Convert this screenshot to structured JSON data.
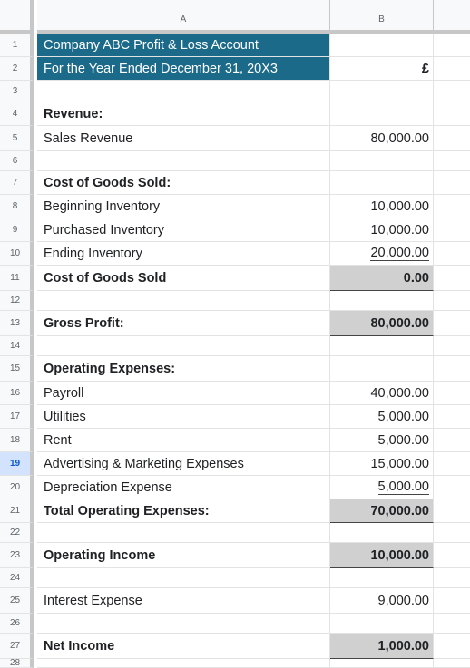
{
  "columns": [
    "A",
    "B"
  ],
  "selected_row": "19",
  "rows": [
    {
      "num": "1",
      "a": "Company ABC Profit & Loss Account",
      "b": "",
      "style": "title"
    },
    {
      "num": "2",
      "a": "For the Year Ended December 31, 20X3",
      "b": "£",
      "style": "title"
    },
    {
      "num": "3",
      "a": "",
      "b": "",
      "style": "blank"
    },
    {
      "num": "4",
      "a": "Revenue:",
      "b": "",
      "style": "header"
    },
    {
      "num": "5",
      "a": "Sales Revenue",
      "b": "80,000.00",
      "style": "normal"
    },
    {
      "num": "6",
      "a": "",
      "b": "",
      "style": "blank"
    },
    {
      "num": "7",
      "a": "Cost of Goods Sold:",
      "b": "",
      "style": "header"
    },
    {
      "num": "8",
      "a": "Beginning Inventory",
      "b": "10,000.00",
      "style": "normal"
    },
    {
      "num": "9",
      "a": "Purchased Inventory",
      "b": "10,000.00",
      "style": "normal"
    },
    {
      "num": "10",
      "a": "Ending Inventory",
      "b": "20,000.00",
      "style": "underline"
    },
    {
      "num": "11",
      "a": "Cost of Goods Sold",
      "b": "0.00",
      "style": "total"
    },
    {
      "num": "12",
      "a": "",
      "b": "",
      "style": "blank"
    },
    {
      "num": "13",
      "a": "Gross Profit:",
      "b": "80,000.00",
      "style": "total"
    },
    {
      "num": "14",
      "a": "",
      "b": "",
      "style": "blank"
    },
    {
      "num": "15",
      "a": "Operating Expenses:",
      "b": "",
      "style": "header"
    },
    {
      "num": "16",
      "a": "Payroll",
      "b": "40,000.00",
      "style": "normal"
    },
    {
      "num": "17",
      "a": "Utilities",
      "b": "5,000.00",
      "style": "normal"
    },
    {
      "num": "18",
      "a": "Rent",
      "b": "5,000.00",
      "style": "normal"
    },
    {
      "num": "19",
      "a": "Advertising & Marketing Expenses",
      "b": "15,000.00",
      "style": "normal"
    },
    {
      "num": "20",
      "a": "Depreciation Expense",
      "b": "5,000.00",
      "style": "underline"
    },
    {
      "num": "21",
      "a": "Total Operating Expenses:",
      "b": "70,000.00",
      "style": "total"
    },
    {
      "num": "22",
      "a": "",
      "b": "",
      "style": "blank"
    },
    {
      "num": "23",
      "a": "Operating Income",
      "b": "10,000.00",
      "style": "total"
    },
    {
      "num": "24",
      "a": "",
      "b": "",
      "style": "blank"
    },
    {
      "num": "25",
      "a": "Interest Expense",
      "b": "9,000.00",
      "style": "normal"
    },
    {
      "num": "26",
      "a": "",
      "b": "",
      "style": "blank"
    },
    {
      "num": "27",
      "a": "Net Income",
      "b": "1,000.00",
      "style": "total"
    },
    {
      "num": "28",
      "a": "",
      "b": "",
      "style": "blank"
    }
  ]
}
